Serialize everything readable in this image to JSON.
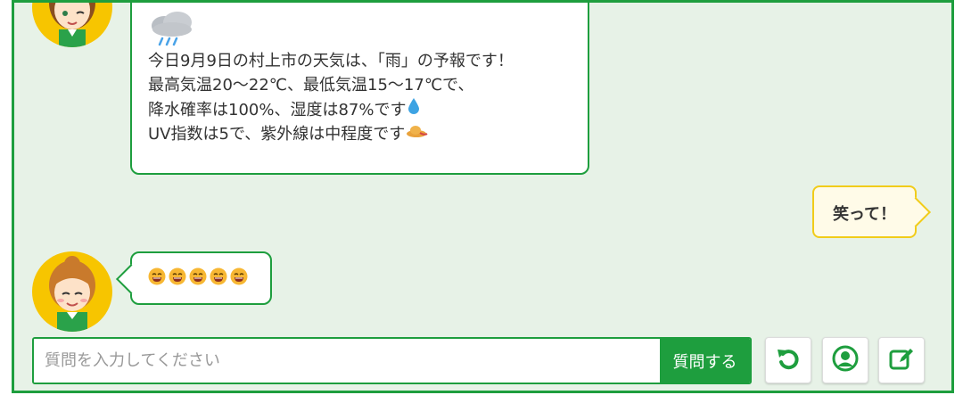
{
  "colors": {
    "brand_green": "#1e9e3e",
    "panel_bg": "#e7f2e7",
    "user_bubble_border": "#f1cc1a",
    "avatar_bg": "#f7c500"
  },
  "chat": {
    "weather_message": {
      "icon": "rain-cloud-icon",
      "lines": [
        "今日9月9日の村上市の天気は、「雨」の予報です！",
        "最高気温20～22℃、最低気温15～17℃で、",
        "降水確率は100%、湿度は87%です",
        "UV指数は5で、紫外線は中程度です"
      ],
      "humidity_icon": "water-drop-icon",
      "uv_icon": "sun-hat-icon"
    },
    "user_message": "笑って！",
    "emoji_message": {
      "icon": "smiling-face-icon",
      "count": 5
    }
  },
  "composer": {
    "placeholder": "質問を入力してください",
    "value": "",
    "submit_label": "質問する"
  },
  "toolbar": {
    "reset_icon": "reset-icon",
    "profile_icon": "user-circle-icon",
    "edit_icon": "edit-icon"
  }
}
